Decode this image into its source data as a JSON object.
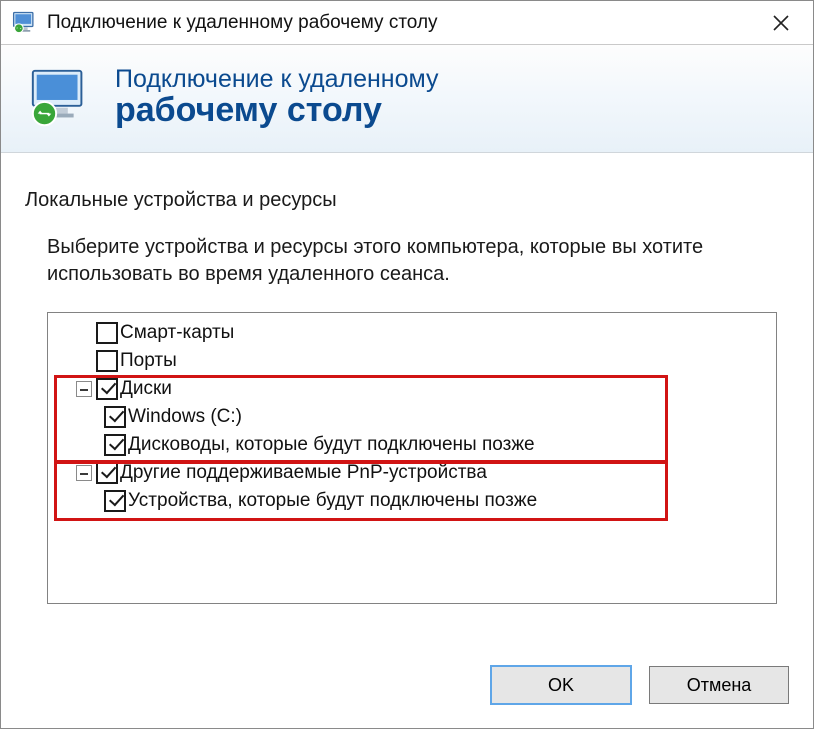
{
  "window": {
    "title": "Подключение к удаленному рабочему столу"
  },
  "banner": {
    "line1": "Подключение к удаленному",
    "line2": "рабочему столу"
  },
  "section": {
    "title": "Локальные устройства и ресурсы",
    "instruction": "Выберите устройства и ресурсы этого компьютера, которые вы хотите использовать во время удаленного сеанса."
  },
  "tree": {
    "items": [
      {
        "label": "Смарт-карты",
        "level": 1,
        "checked": false,
        "expander": null
      },
      {
        "label": "Порты",
        "level": 1,
        "checked": false,
        "expander": null
      },
      {
        "label": "Диски",
        "level": 1,
        "checked": true,
        "expander": "minus"
      },
      {
        "label": "Windows (C:)",
        "level": 2,
        "checked": true,
        "expander": null
      },
      {
        "label": "Дисководы, которые будут подключены позже",
        "level": 2,
        "checked": true,
        "expander": null
      },
      {
        "label": "Другие поддерживаемые PnP-устройства",
        "level": 1,
        "checked": true,
        "expander": "minus"
      },
      {
        "label": "Устройства, которые будут подключены позже",
        "level": 2,
        "checked": true,
        "expander": null
      }
    ]
  },
  "buttons": {
    "ok": "OK",
    "cancel": "Отмена"
  }
}
